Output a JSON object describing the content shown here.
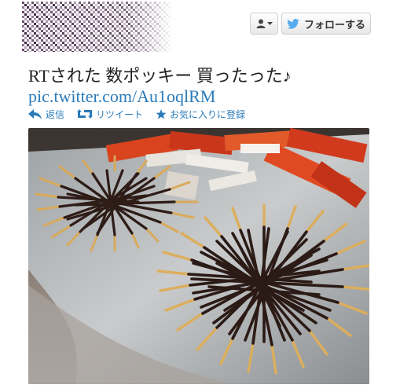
{
  "header": {
    "follow_label": "フォローする"
  },
  "icons": {
    "user": "user-icon",
    "caret": "caret-down-icon",
    "bird": "twitter-bird-icon",
    "reply": "reply-icon",
    "retweet": "retweet-icon",
    "favorite": "star-icon"
  },
  "tweet": {
    "text": "RTされた 数ポッキー 買ったった♪",
    "link": "pic.twitter.com/Au1oqlRM"
  },
  "actions": {
    "reply_label": "返信",
    "retweet_label": "リツイート",
    "favorite_label": "お気に入りに登録"
  },
  "colors": {
    "link": "#2b7bb9",
    "bird": "#55acee"
  }
}
